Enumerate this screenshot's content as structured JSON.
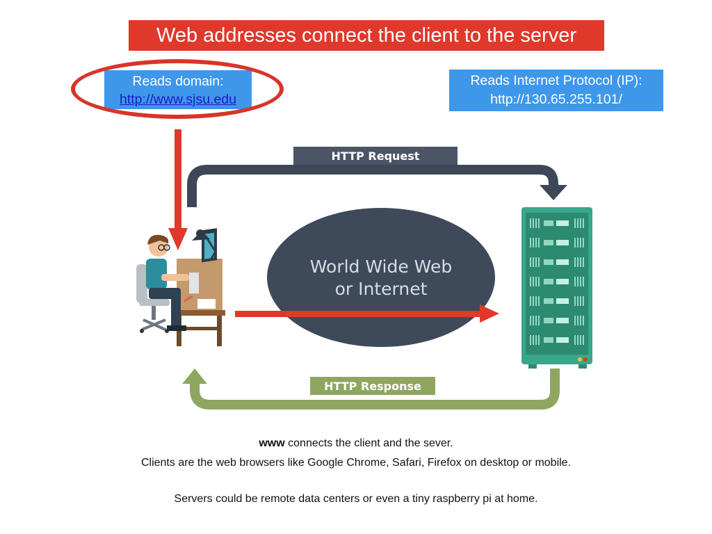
{
  "slide": {
    "title": "Web addresses connect the client to the server",
    "domain_box": {
      "line1": "Reads domain:",
      "link": "http://www.sjsu.edu"
    },
    "ip_box": {
      "line1": "Reads Internet Protocol (IP):",
      "line2": "http://130.65.255.101/"
    },
    "diagram": {
      "request_label": "HTTP Request",
      "response_label": "HTTP Response",
      "web_label_line1": "World Wide Web",
      "web_label_line2": "or Internet"
    },
    "captions": {
      "line1_bold": "www",
      "line1_rest": " connects the client and the sever.",
      "line2": "Clients are the web browsers like Google Chrome, Safari, Firefox on desktop or mobile.",
      "line3": "Servers could be remote data centers or even a tiny raspberry pi at home."
    }
  },
  "colors": {
    "title_bg": "#e0382a",
    "box_bg": "#3f97ea",
    "link": "#1a1ac8",
    "accent_red": "#e0382a",
    "request_arrow": "#3d4757",
    "response_arrow": "#8fa660",
    "internet_ellipse": "#3e4a5a",
    "server": "#3aa68a"
  }
}
